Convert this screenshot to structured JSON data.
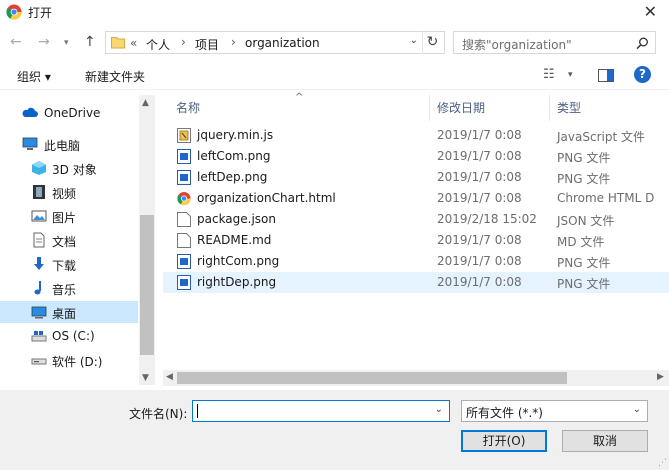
{
  "window": {
    "title": "打开"
  },
  "address": {
    "overflow": "«",
    "crumbs": [
      "个人",
      "项目",
      "organization"
    ]
  },
  "search": {
    "placeholder": "搜索\"organization\""
  },
  "toolbar": {
    "organize": "组织 ▾",
    "new_folder": "新建文件夹"
  },
  "nav": [
    {
      "label": "OneDrive",
      "icon": "cloud-icon"
    },
    {
      "label": "此电脑",
      "icon": "computer-icon"
    },
    {
      "label": "3D 对象",
      "icon": "cube-3d-icon"
    },
    {
      "label": "视频",
      "icon": "film-icon"
    },
    {
      "label": "图片",
      "icon": "picture-icon"
    },
    {
      "label": "文档",
      "icon": "document-icon"
    },
    {
      "label": "下载",
      "icon": "download-arrow-icon"
    },
    {
      "label": "音乐",
      "icon": "music-note-icon"
    },
    {
      "label": "桌面",
      "icon": "desktop-icon",
      "selected": true
    },
    {
      "label": "OS (C:)",
      "icon": "os-drive-icon"
    },
    {
      "label": "软件 (D:)",
      "icon": "drive-icon"
    }
  ],
  "columns": {
    "name": "名称",
    "date": "修改日期",
    "type": "类型"
  },
  "files": [
    {
      "name": "jquery.min.js",
      "date": "2019/1/7 0:08",
      "type": "JavaScript 文件",
      "icon": "js-file-icon"
    },
    {
      "name": "leftCom.png",
      "date": "2019/1/7 0:08",
      "type": "PNG 文件",
      "icon": "image-file-icon"
    },
    {
      "name": "leftDep.png",
      "date": "2019/1/7 0:08",
      "type": "PNG 文件",
      "icon": "image-file-icon"
    },
    {
      "name": "organizationChart.html",
      "date": "2019/1/7 0:08",
      "type": "Chrome HTML D",
      "icon": "chrome-icon"
    },
    {
      "name": "package.json",
      "date": "2019/2/18 15:02",
      "type": "JSON 文件",
      "icon": "json-file-icon"
    },
    {
      "name": "README.md",
      "date": "2019/1/7 0:08",
      "type": "MD 文件",
      "icon": "blank-file-icon"
    },
    {
      "name": "rightCom.png",
      "date": "2019/1/7 0:08",
      "type": "PNG 文件",
      "icon": "image-file-icon"
    },
    {
      "name": "rightDep.png",
      "date": "2019/1/7 0:08",
      "type": "PNG 文件",
      "icon": "image-file-icon",
      "selected": true
    }
  ],
  "footer": {
    "filename_label": "文件名(N):",
    "filename_value": "",
    "filter_value": "所有文件 (*.*)",
    "open_label": "打开(O)",
    "cancel_label": "取消"
  },
  "colors": {
    "accent": "#0078d7",
    "selected_nav": "#cce8ff",
    "selected_row": "#e5f3ff",
    "header_text": "#4d6082"
  }
}
